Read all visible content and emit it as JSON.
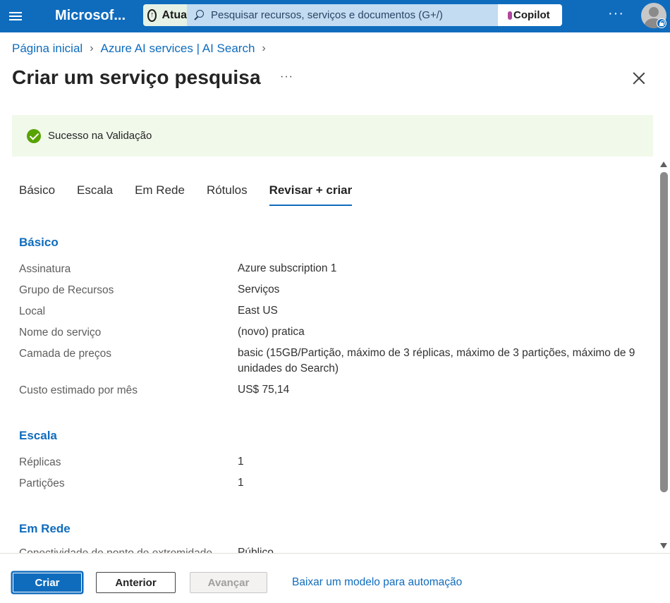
{
  "topbar": {
    "brand": "Microsof...",
    "update_label": "Atua",
    "search_placeholder": "Pesquisar recursos, serviços e documentos (G+/)",
    "copilot_label": "Copilot",
    "more": "···"
  },
  "breadcrumb": {
    "items": [
      "Página inicial",
      "Azure AI services | AI Search"
    ]
  },
  "page": {
    "title": "Criar um serviço pesquisa",
    "more": "···"
  },
  "banner": {
    "text": "Sucesso na Validação"
  },
  "tabs": [
    {
      "label": "Básico",
      "active": false
    },
    {
      "label": "Escala",
      "active": false
    },
    {
      "label": "Em Rede",
      "active": false
    },
    {
      "label": "Rótulos",
      "active": false
    },
    {
      "label": "Revisar + criar",
      "active": true
    }
  ],
  "sections": {
    "basico": {
      "title": "Básico",
      "rows": [
        {
          "label": "Assinatura",
          "value": "Azure subscription 1"
        },
        {
          "label": "Grupo de Recursos",
          "value": "Serviços"
        },
        {
          "label": "Local",
          "value": "East US"
        },
        {
          "label": "Nome do serviço",
          "value": "(novo) pratica"
        },
        {
          "label": "Camada de preços",
          "value": "basic (15GB/Partição, máximo de 3 réplicas, máximo de 3 partições, máximo de 9 unidades do Search)"
        },
        {
          "label": "Custo estimado por mês",
          "value": "US$ 75,14"
        }
      ]
    },
    "escala": {
      "title": "Escala",
      "rows": [
        {
          "label": "Réplicas",
          "value": "1"
        },
        {
          "label": "Partições",
          "value": "1"
        }
      ]
    },
    "rede": {
      "title": "Em Rede",
      "rows": [
        {
          "label": "Conectividade de ponto de extremidade",
          "value": "Público"
        }
      ]
    }
  },
  "footer": {
    "create": "Criar",
    "previous": "Anterior",
    "next": "Avançar",
    "download_link": "Baixar um modelo para automação"
  }
}
